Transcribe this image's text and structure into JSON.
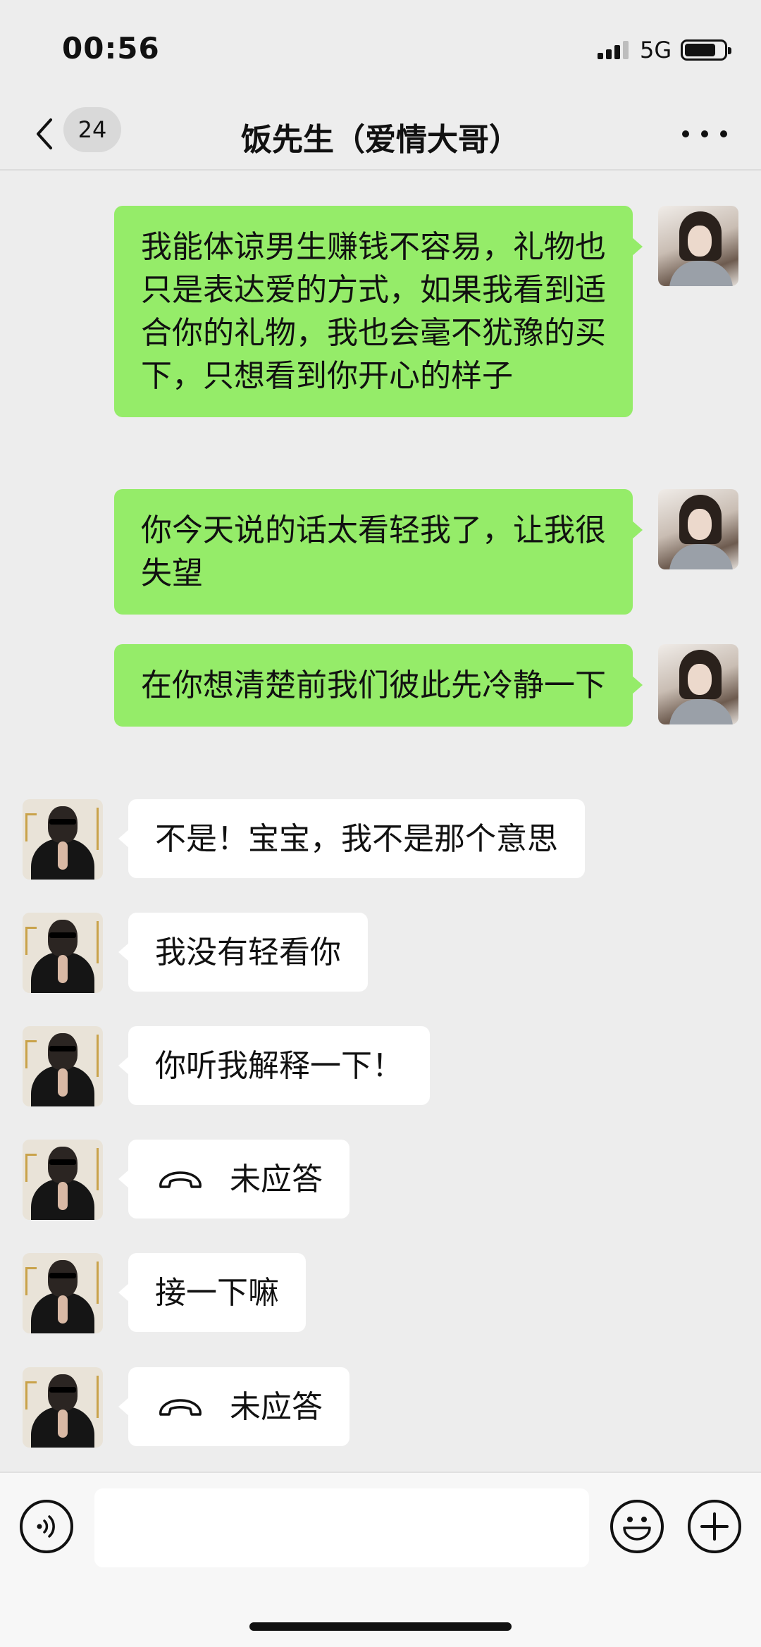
{
  "status_bar": {
    "time": "00:56",
    "network": "5G",
    "icons": [
      "signal-icon",
      "battery-icon"
    ]
  },
  "header": {
    "back_icon": "chevron-left-icon",
    "unread_count": "24",
    "title": "饭先生（爱情大哥）",
    "more_icon": "more-dots-icon"
  },
  "messages": [
    {
      "from": "self",
      "text": "我能体谅男生赚钱不容易，礼物也只是表达爱的方式，如果我看到适合你的礼物，我也会毫不犹豫的买下，只想看到你开心的样子"
    },
    {
      "from": "self",
      "text": "你今天说的话太看轻我了，让我很失望"
    },
    {
      "from": "self",
      "text": "在你想清楚前我们彼此先冷静一下"
    },
    {
      "from": "other",
      "text": "不是！宝宝，我不是那个意思"
    },
    {
      "from": "other",
      "text": "我没有轻看你"
    },
    {
      "from": "other",
      "text": "你听我解释一下！"
    },
    {
      "from": "other",
      "type": "call",
      "icon": "phone-hangup-icon",
      "text": "未应答"
    },
    {
      "from": "other",
      "text": "接一下嘛"
    },
    {
      "from": "other",
      "type": "call",
      "icon": "phone-hangup-icon",
      "text": "未应答"
    }
  ],
  "input_bar": {
    "voice_icon": "voice-icon",
    "input_value": "",
    "emoji_icon": "emoji-icon",
    "plus_icon": "plus-icon"
  },
  "colors": {
    "background": "#ededed",
    "sent_bubble": "#95ec69",
    "received_bubble": "#ffffff",
    "bottom_bar": "#f7f7f7"
  }
}
